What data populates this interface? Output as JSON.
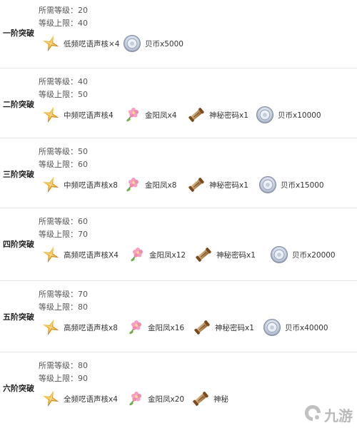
{
  "tiers": [
    {
      "label": "一阶突破",
      "req_level": "所需等级：20",
      "cap_level": "等级上限：40",
      "items": [
        {
          "icon": "star-shard-icon",
          "label": "低频呓语声核×4"
        },
        {
          "icon": "coin-icon",
          "label": "贝币x5000"
        }
      ]
    },
    {
      "label": "二阶突破",
      "req_level": "所需等级：40",
      "cap_level": "等级上限：50",
      "items": [
        {
          "icon": "star-shard-icon",
          "label": "中频呓语声核4"
        },
        {
          "icon": "flower-icon",
          "label": "金阳凤x4"
        },
        {
          "icon": "scroll-icon",
          "label": "神秘密码x1"
        },
        {
          "icon": "coin-icon",
          "label": "贝币x10000"
        }
      ]
    },
    {
      "label": "三阶突破",
      "req_level": "所需等级：50",
      "cap_level": "等级上限：60",
      "items": [
        {
          "icon": "star-shard-icon",
          "label": "中频呓语声核x8"
        },
        {
          "icon": "flower-icon",
          "label": "金阳凤x8"
        },
        {
          "icon": "scroll-icon",
          "label": "神秘密码x1"
        },
        {
          "icon": "coin-icon",
          "label": "贝币x15000"
        }
      ]
    },
    {
      "label": "四阶突破",
      "req_level": "所需等级：60",
      "cap_level": "等级上限：70",
      "items": [
        {
          "icon": "star-shard-icon",
          "label": "高频呓语声核X4"
        },
        {
          "icon": "flower-icon",
          "label": "金阳凤x12"
        },
        {
          "icon": "scroll-icon",
          "label": "神秘密码x1"
        },
        {
          "icon": "coin-icon",
          "label": "贝币x20000"
        }
      ]
    },
    {
      "label": "五阶突破",
      "req_level": "所需等级：70",
      "cap_level": "等级上限：80",
      "items": [
        {
          "icon": "star-shard-icon",
          "label": "高频呓语声核x8"
        },
        {
          "icon": "flower-icon",
          "label": "金阳凤x16"
        },
        {
          "icon": "scroll-icon",
          "label": "神秘密码x1"
        },
        {
          "icon": "coin-icon",
          "label": "贝币x40000"
        }
      ]
    },
    {
      "label": "六阶突破",
      "req_level": "所需等级：80",
      "cap_level": "等级上限：90",
      "items": [
        {
          "icon": "star-shard-icon",
          "label": "全频呓语声核x4"
        },
        {
          "icon": "flower-icon",
          "label": "金阳凤x20"
        },
        {
          "icon": "scroll-icon",
          "label": "神秘"
        }
      ]
    }
  ],
  "watermark": {
    "text": "九游",
    "icon": "jiuyou-logo-icon"
  }
}
